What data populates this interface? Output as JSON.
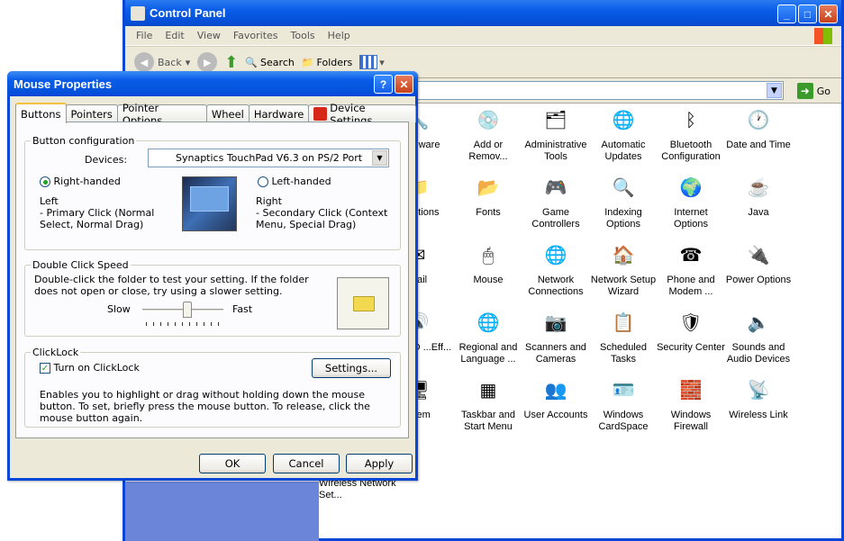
{
  "control_panel": {
    "title": "Control Panel",
    "menu": [
      "File",
      "Edit",
      "View",
      "Favorites",
      "Tools",
      "Help"
    ],
    "toolbar": {
      "back": "Back",
      "search": "Search",
      "folders": "Folders"
    },
    "address": {
      "go": "Go"
    },
    "side_link": "Wireless Network Set...",
    "items": [
      {
        "label": "...ardware",
        "icon": "hardware-icon",
        "glyph": "🔧"
      },
      {
        "label": "Add or Remov...",
        "icon": "add-remove-programs-icon",
        "glyph": "💿"
      },
      {
        "label": "Administrative Tools",
        "icon": "administrative-tools-icon",
        "glyph": "🗂"
      },
      {
        "label": "Automatic Updates",
        "icon": "automatic-updates-icon",
        "glyph": "🌐"
      },
      {
        "label": "Bluetooth Configuration",
        "icon": "bluetooth-icon",
        "glyph": "ᛒ"
      },
      {
        "label": "Date and Time",
        "icon": "clock-icon",
        "glyph": "🕐"
      },
      {
        "label": "...Options",
        "icon": "folder-options-icon",
        "glyph": "📁"
      },
      {
        "label": "Fonts",
        "icon": "fonts-folder-icon",
        "glyph": "📂"
      },
      {
        "label": "Game Controllers",
        "icon": "game-controller-icon",
        "glyph": "🎮"
      },
      {
        "label": "Indexing Options",
        "icon": "indexing-icon",
        "glyph": "🔍"
      },
      {
        "label": "Internet Options",
        "icon": "internet-options-icon",
        "glyph": "🌍"
      },
      {
        "label": "Java",
        "icon": "java-icon",
        "glyph": "☕"
      },
      {
        "label": "...ail",
        "icon": "mail-icon",
        "glyph": "✉"
      },
      {
        "label": "Mouse",
        "icon": "mouse-icon",
        "glyph": "🖱"
      },
      {
        "label": "Network Connections",
        "icon": "network-connections-icon",
        "glyph": "🌐"
      },
      {
        "label": "Network Setup Wizard",
        "icon": "network-setup-icon",
        "glyph": "🏠"
      },
      {
        "label": "Phone and Modem ...",
        "icon": "phone-modem-icon",
        "glyph": "☎"
      },
      {
        "label": "Power Options",
        "icon": "power-options-icon",
        "glyph": "🔌"
      },
      {
        "label": "...ek HD ...Eff...",
        "icon": "audio-manager-icon",
        "glyph": "🔊"
      },
      {
        "label": "Regional and Language ...",
        "icon": "globe-icon",
        "glyph": "🌐"
      },
      {
        "label": "Scanners and Cameras",
        "icon": "scanner-icon",
        "glyph": "📷"
      },
      {
        "label": "Scheduled Tasks",
        "icon": "scheduled-tasks-icon",
        "glyph": "📋"
      },
      {
        "label": "Security Center",
        "icon": "shield-icon",
        "glyph": "🛡"
      },
      {
        "label": "Sounds and Audio Devices",
        "icon": "speaker-icon",
        "glyph": "🔈"
      },
      {
        "label": "...tem",
        "icon": "system-icon",
        "glyph": "🖥"
      },
      {
        "label": "Taskbar and Start Menu",
        "icon": "taskbar-icon",
        "glyph": "▦"
      },
      {
        "label": "User Accounts",
        "icon": "user-accounts-icon",
        "glyph": "👥"
      },
      {
        "label": "Windows CardSpace",
        "icon": "cardspace-icon",
        "glyph": "🪪"
      },
      {
        "label": "Windows Firewall",
        "icon": "firewall-icon",
        "glyph": "🧱"
      },
      {
        "label": "Wireless Link",
        "icon": "wireless-link-icon",
        "glyph": "📡"
      }
    ]
  },
  "dialog": {
    "title": "Mouse Properties",
    "tabs": [
      "Buttons",
      "Pointers",
      "Pointer Options",
      "Wheel",
      "Hardware",
      "Device Settings"
    ],
    "active_tab": "Buttons",
    "button_config": {
      "legend": "Button configuration",
      "devices_label": "Devices:",
      "devices_value": "Synaptics TouchPad V6.3 on PS/2 Port",
      "right_handed": "Right-handed",
      "left_handed": "Left-handed",
      "right_handed_selected": true,
      "left_title": "Left",
      "left_desc": " - Primary Click (Normal Select, Normal Drag)",
      "right_title": "Right",
      "right_desc": " - Secondary Click (Context Menu, Special Drag)"
    },
    "double_click": {
      "legend": "Double Click Speed",
      "desc": "Double-click the folder to test your setting.  If the folder does not open or close, try using a slower setting.",
      "slow": "Slow",
      "fast": "Fast",
      "speed_fraction": 0.55
    },
    "clicklock": {
      "legend": "ClickLock",
      "checkbox": "Turn on ClickLock",
      "checked": true,
      "settings": "Settings...",
      "desc": "Enables you to highlight or drag without holding down the mouse button.  To set, briefly press the mouse button.  To release, click the mouse button again."
    },
    "buttons": {
      "ok": "OK",
      "cancel": "Cancel",
      "apply": "Apply"
    }
  }
}
